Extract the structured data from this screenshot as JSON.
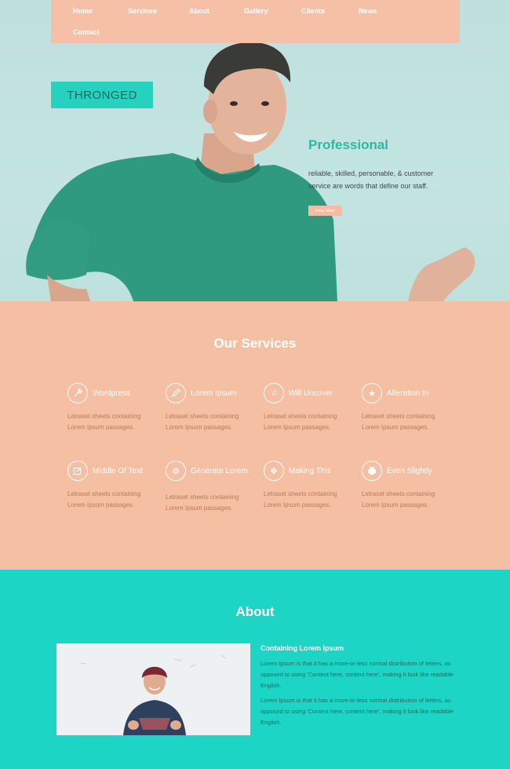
{
  "nav": {
    "items": [
      "Home",
      "Services",
      "About",
      "Gallery",
      "Clients",
      "News",
      "Contact"
    ]
  },
  "brand": {
    "logo": "THRONGED"
  },
  "hero": {
    "title": "Professional",
    "text": "reliable, skilled, personable, & customer service are words that define our staff.",
    "button": "Read More"
  },
  "services": {
    "title": "Our Services",
    "items": [
      {
        "name": "Wordpress",
        "icon": "wrench-icon",
        "desc1": "Letraset sheets containing",
        "desc2": "Lorem Ipsum passages."
      },
      {
        "name": "Lorem Ipsum",
        "icon": "pencil-icon",
        "desc1": "Letraset sheets containing",
        "desc2": "Lorem Ipsum passages."
      },
      {
        "name": "Will Uncover",
        "icon": "music-note-icon",
        "desc1": "Letraset sheets containing",
        "desc2": "Lorem Ipsum passages."
      },
      {
        "name": "Alteration In",
        "icon": "star-icon",
        "desc1": "Letraset sheets containing",
        "desc2": "Lorem Ipsum passages."
      },
      {
        "name": "Middle Of Text",
        "icon": "edit-icon",
        "desc1": "Letraset sheets containing",
        "desc2": "Lorem Ipsum passages."
      },
      {
        "name": "Generate Lorem",
        "icon": "gear-icon",
        "desc1": "Letraset sheets containing",
        "desc2": "Lorem Ipsum passages."
      },
      {
        "name": "Making This",
        "icon": "move-icon",
        "desc1": "Letraset sheets containing",
        "desc2": "Lorem Ipsum passages."
      },
      {
        "name": "Even Slightly",
        "icon": "printer-icon",
        "desc1": "Letraset sheets containing",
        "desc2": "Lorem Ipsum passages."
      }
    ]
  },
  "about": {
    "title": "About",
    "subtitle": "Containing Lorem Ipsum",
    "p1": "Lorem Ipsum is that it has a more-or-less normal distribution of letters, as opposed to using 'Content here, content here', making it look like readable English.",
    "p2": "Lorem Ipsum is that it has a more-or-less normal distribution of letters, as opposed to using 'Content here, content here', making it look like readable English."
  },
  "colors": {
    "nav": "#f5c0a5",
    "teal": "#1dd5c4",
    "peach": "#f5bfa3",
    "hero_bg": "#c4e3e0"
  }
}
